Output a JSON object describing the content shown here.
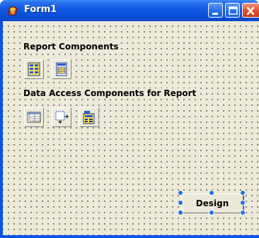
{
  "window": {
    "title": "Form1"
  },
  "groups": {
    "report": {
      "label": "Report Components"
    },
    "data_access": {
      "label": "Data Access Components for Report"
    }
  },
  "design_button": {
    "label": "Design"
  },
  "icons": {
    "app": "delphi-helmet-icon",
    "report_1": "report-grid-icon",
    "report_2": "report-page-icon",
    "data_1": "data-table-icon",
    "data_2": "data-link-icon",
    "data_3": "data-pipeline-icon"
  },
  "colors": {
    "titlebar": "#0a53e0",
    "client": "#ece9d8",
    "close": "#e0512d",
    "selection": "#1f6fe8"
  }
}
